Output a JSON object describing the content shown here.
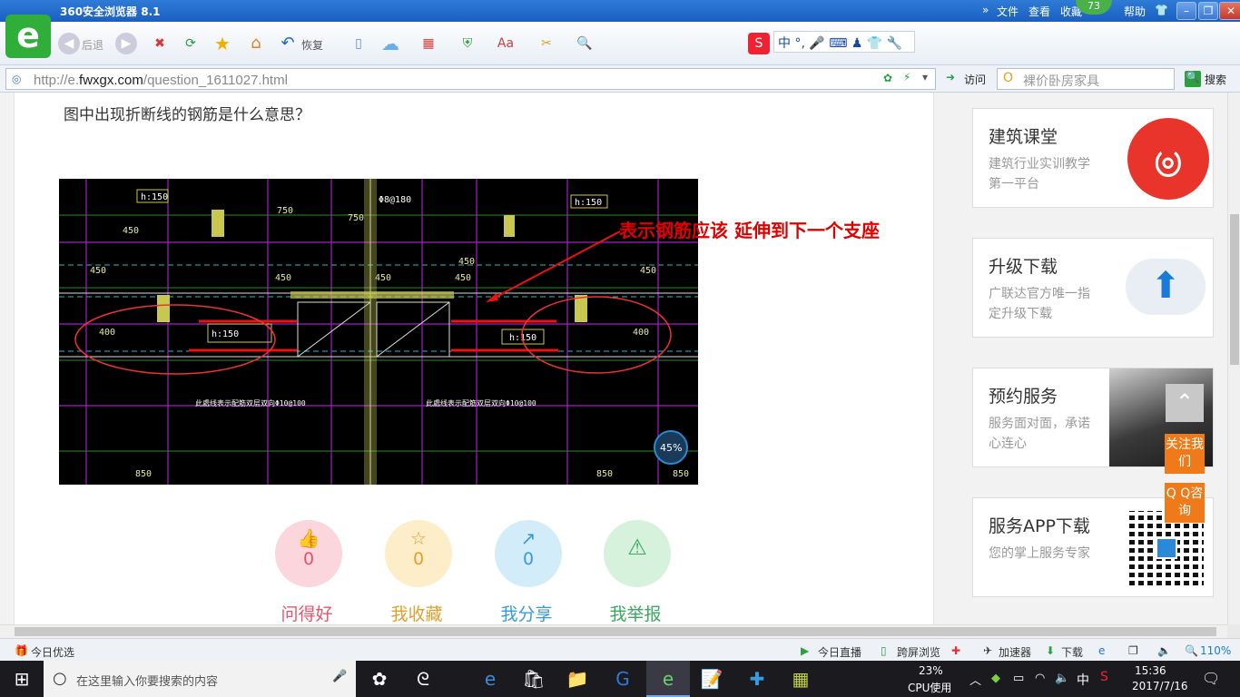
{
  "browser": {
    "title": "360安全浏览器 8.1",
    "menu": [
      "文件",
      "查看",
      "收藏",
      "帮助"
    ],
    "badge": "73",
    "back_label": "后退",
    "restore_label": "恢复",
    "url_prefix": "http://e.",
    "url_domain": "fwxgx.com",
    "url_path": "/question_1611027.html",
    "visit_label": "访问",
    "search_placeholder": "裸价卧房家具",
    "search_button": "搜索"
  },
  "page": {
    "question": "图中出现折断线的钢筋是什么意思？",
    "annotation": "表示钢筋应该 延伸到下一个支座",
    "cad": {
      "labels_h150": "h:150",
      "dims": [
        "750",
        "750",
        "450",
        "450",
        "450",
        "450",
        "400",
        "400",
        "850",
        "850",
        "850",
        "450",
        "450",
        "450"
      ],
      "rebar_note": "此處线表示配筋双层双向Φ10@100",
      "rebar_top": "Φ8@180",
      "zoom": "45%"
    },
    "actions": [
      {
        "label": "问得好",
        "count": "0",
        "color": "#e0566e",
        "bg": "#fbd6dc"
      },
      {
        "label": "我收藏",
        "count": "0",
        "color": "#e0a030",
        "bg": "#fdedc8"
      },
      {
        "label": "我分享",
        "count": "0",
        "color": "#3a9ad8",
        "bg": "#d3ecfa"
      },
      {
        "label": "我举报",
        "count": "",
        "color": "#3aa860",
        "bg": "#d6f2dc"
      }
    ]
  },
  "sidebar": [
    {
      "title": "建筑课堂",
      "desc": "建筑行业实训教学第一平台"
    },
    {
      "title": "升级下载",
      "desc": "广联达官方唯一指定升级下载"
    },
    {
      "title": "预约服务",
      "desc": "服务面对面，承诺心连心"
    },
    {
      "title": "服务APP下载",
      "desc": "您的掌上服务专家"
    }
  ],
  "float": {
    "follow": "关注我们",
    "qq": "Q Q咨询"
  },
  "statusbar": {
    "today": "今日优选",
    "live": "今日直播",
    "cross": "跨屏浏览",
    "accel": "加速器",
    "download": "下载",
    "zoom": "110%"
  },
  "taskbar": {
    "search_placeholder": "在这里输入你要搜索的内容",
    "cpu_percent": "23%",
    "cpu_label": "CPU使用",
    "ime": "中",
    "time": "15:36",
    "date": "2017/7/16"
  }
}
